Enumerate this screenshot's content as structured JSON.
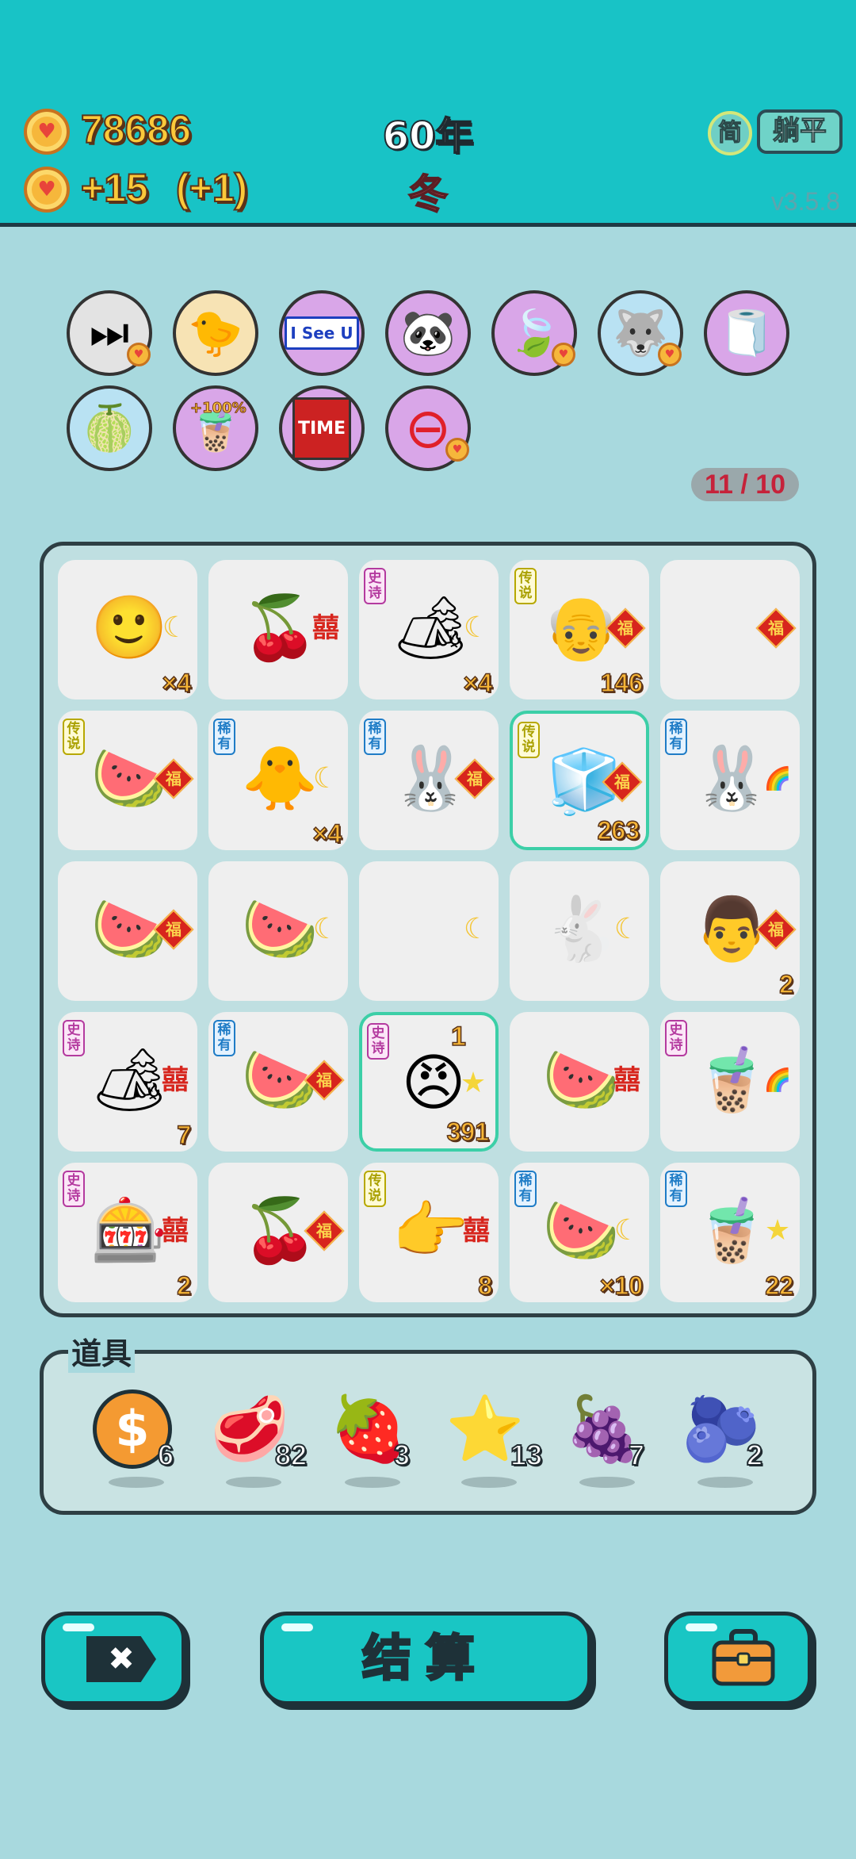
{
  "header": {
    "coins": "78686",
    "income": "+15",
    "income_bonus": "(+1)",
    "year": "60年",
    "season": "冬",
    "simplified_label": "简",
    "flat_label": "躺平",
    "version": "v3.5.8"
  },
  "relics": {
    "counter": "11 / 10",
    "items": [
      {
        "name": "skip-icon",
        "glyph": "⏭",
        "bg": "#e3e3e3"
      },
      {
        "name": "chick-egg-icon",
        "glyph": "🐤",
        "bg": "#f7e3b4"
      },
      {
        "name": "i-see-u-sign-icon",
        "glyph": "I See U",
        "bg": "#d9a6e8"
      },
      {
        "name": "panda-icon",
        "glyph": "🐼",
        "bg": "#d9a6e8"
      },
      {
        "name": "leaf-icon",
        "glyph": "🍃",
        "bg": "#d9a6e8"
      },
      {
        "name": "husky-icon",
        "glyph": "🐺",
        "bg": "#b9e2f3"
      },
      {
        "name": "tissue-box-icon",
        "glyph": "🧻",
        "bg": "#d9a6e8"
      },
      {
        "name": "pomelo-icon",
        "glyph": "🍈",
        "bg": "#b9e2f3"
      },
      {
        "name": "boba-cup-plus-100-icon",
        "glyph": "🧋",
        "bg": "#d9a6e8",
        "label": "+100%"
      },
      {
        "name": "time-magazine-icon",
        "glyph": "TIME",
        "bg": "#d9a6e8"
      },
      {
        "name": "minus-circle-icon",
        "glyph": "⊖",
        "bg": "#d9a6e8"
      }
    ]
  },
  "board": {
    "cells": [
      {
        "icon": "🙂",
        "icon_name": "man-face-icon",
        "tag": "",
        "side": "moon",
        "num": "×4"
      },
      {
        "icon": "🍒",
        "icon_name": "cherry-icon",
        "tag": "",
        "side": "xi",
        "num": ""
      },
      {
        "icon": "🏕",
        "icon_name": "bunny-tent-icon",
        "tag": "史诗",
        "tag_class": "epic",
        "side": "moon",
        "num": "×4"
      },
      {
        "icon": "👴",
        "icon_name": "grandpa-glasses-icon",
        "tag": "传说",
        "tag_class": "legend",
        "side": "fu",
        "num": "146"
      },
      {
        "icon": "",
        "icon_name": "empty-slot-icon",
        "tag": "",
        "side": "fu",
        "num": ""
      },
      {
        "icon": "🍉",
        "icon_name": "whole-watermelon-icon",
        "tag": "传说",
        "tag_class": "legend",
        "side": "fu",
        "num": ""
      },
      {
        "icon": "🐥",
        "icon_name": "chick-icon",
        "tag": "稀有",
        "tag_class": "rare",
        "side": "moon",
        "num": "×4"
      },
      {
        "icon": "🐰",
        "icon_name": "bunny-icon",
        "tag": "稀有",
        "tag_class": "rare",
        "side": "fu",
        "num": ""
      },
      {
        "icon": "🧊",
        "icon_name": "fridge-icon",
        "tag": "传说",
        "tag_class": "legend",
        "side": "fu",
        "num": "263",
        "selected": true
      },
      {
        "icon": "🐰",
        "icon_name": "bunny-icon",
        "tag": "稀有",
        "tag_class": "rare",
        "side": "rainbow",
        "num": ""
      },
      {
        "icon": "🍉",
        "icon_name": "watermelon-slice-icon",
        "tag": "",
        "side": "fu",
        "num": ""
      },
      {
        "icon": "🍉",
        "icon_name": "watermelon-slice-icon",
        "tag": "",
        "side": "moon",
        "num": ""
      },
      {
        "icon": "",
        "icon_name": "empty-slot-icon",
        "tag": "",
        "side": "moon",
        "num": ""
      },
      {
        "icon": "🐇",
        "icon_name": "faded-bunny-icon",
        "tag": "",
        "side": "moon",
        "num": "",
        "faded": true
      },
      {
        "icon": "👨",
        "icon_name": "old-man-glasses-icon",
        "tag": "",
        "side": "fu",
        "num": "2"
      },
      {
        "icon": "🏕",
        "icon_name": "bunny-tent-icon",
        "tag": "史诗",
        "tag_class": "epic",
        "side": "xi",
        "num": "7"
      },
      {
        "icon": "🍉",
        "icon_name": "watermelon-slice-icon",
        "tag": "稀有",
        "tag_class": "rare",
        "side": "fu",
        "num": ""
      },
      {
        "icon": "😠",
        "icon_name": "angry-face-icon",
        "tag": "史诗",
        "tag_class": "epic",
        "side": "star",
        "num": "391",
        "top_num": "1",
        "selected": true
      },
      {
        "icon": "🍉",
        "icon_name": "watermelon-slice-icon",
        "tag": "",
        "side": "xi",
        "num": ""
      },
      {
        "icon": "🧋",
        "icon_name": "boba-tea-icon",
        "tag": "史诗",
        "tag_class": "epic",
        "side": "rainbow",
        "num": ""
      },
      {
        "icon": "🎰",
        "icon_name": "gacha-machine-icon",
        "tag": "史诗",
        "tag_class": "epic",
        "side": "xi",
        "num": "2"
      },
      {
        "icon": "🍒",
        "icon_name": "cherry-icon",
        "tag": "",
        "side": "fu",
        "num": ""
      },
      {
        "icon": "👉",
        "icon_name": "pointing-hand-icon",
        "tag": "传说",
        "tag_class": "legend",
        "side": "xi",
        "num": "8"
      },
      {
        "icon": "🍉",
        "icon_name": "watermelon-slice-icon",
        "tag": "稀有",
        "tag_class": "rare",
        "side": "moon",
        "num": "×10"
      },
      {
        "icon": "🧋",
        "icon_name": "boba-tea-icon",
        "tag": "稀有",
        "tag_class": "rare",
        "side": "star",
        "num": "22"
      }
    ]
  },
  "items": {
    "label": "道具",
    "list": [
      {
        "icon_name": "dollar-coin-icon",
        "glyph": "$",
        "count": "6"
      },
      {
        "icon_name": "liver-icon",
        "glyph": "🥩",
        "count": "82"
      },
      {
        "icon_name": "strawberry-icon",
        "glyph": "🍓",
        "count": "3"
      },
      {
        "icon_name": "star-icon",
        "glyph": "⭐",
        "count": "13"
      },
      {
        "icon_name": "lychee-icon",
        "glyph": "🍇",
        "count": "7"
      },
      {
        "icon_name": "blueberry-icon",
        "glyph": "🫐",
        "count": "2"
      }
    ]
  },
  "buttons": {
    "exit_glyph": "✖",
    "settle_label": "结算"
  },
  "side_glyphs": {
    "moon": "☾",
    "xi": "囍",
    "fu": "福",
    "star": "★",
    "rainbow": "🌈"
  }
}
